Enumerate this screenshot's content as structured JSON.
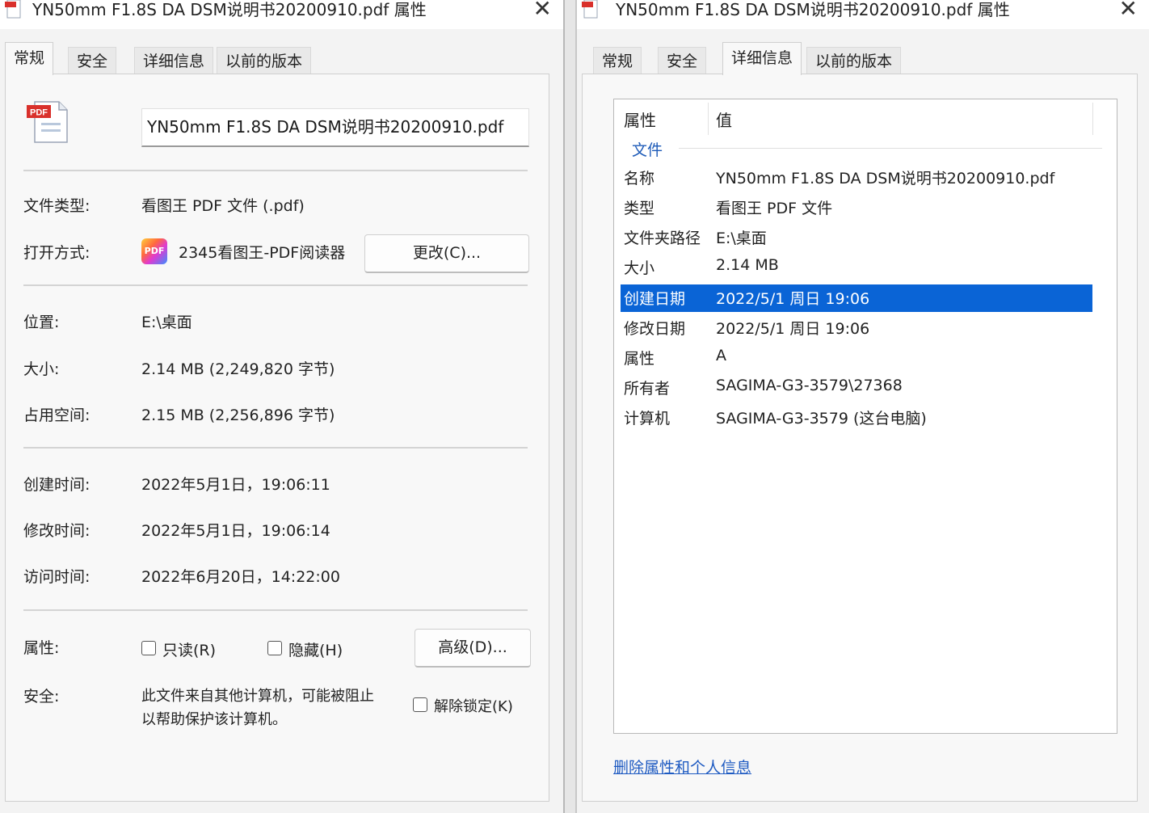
{
  "left": {
    "title": "YN50mm F1.8S DA DSM说明书20200910.pdf 属性",
    "close": "✕",
    "tabs": [
      {
        "label": "常规",
        "active": true
      },
      {
        "label": "安全",
        "active": false
      },
      {
        "label": "详细信息",
        "active": false
      },
      {
        "label": "以前的版本",
        "active": false
      }
    ],
    "pdf_badge": "PDF",
    "file_name": "YN50mm F1.8S DA DSM说明书20200910.pdf",
    "file_type_label": "文件类型:",
    "file_type_value": "看图王 PDF 文件 (.pdf)",
    "open_with_label": "打开方式:",
    "open_with_icon_text": "PDF",
    "open_with_value": "2345看图王-PDF阅读器",
    "change_button": "更改(C)...",
    "location_label": "位置:",
    "location_value": "E:\\桌面",
    "size_label": "大小:",
    "size_value": "2.14 MB (2,249,820 字节)",
    "disk_label": "占用空间:",
    "disk_value": "2.15 MB (2,256,896 字节)",
    "created_label": "创建时间:",
    "created_value": "2022年5月1日，19:06:11",
    "modified_label": "修改时间:",
    "modified_value": "2022年5月1日，19:06:14",
    "accessed_label": "访问时间:",
    "accessed_value": "2022年6月20日，14:22:00",
    "attributes_label": "属性:",
    "readonly_label": "只读(R)",
    "hidden_label": "隐藏(H)",
    "advanced_button": "高级(D)...",
    "security_label": "安全:",
    "security_line1": "此文件来自其他计算机，可能被阻止",
    "security_line2": "以帮助保护该计算机。",
    "unblock_label": "解除锁定(K)"
  },
  "right": {
    "title": "YN50mm F1.8S DA DSM说明书20200910.pdf 属性",
    "close": "✕",
    "tabs": [
      {
        "label": "常规",
        "active": false
      },
      {
        "label": "安全",
        "active": false
      },
      {
        "label": "详细信息",
        "active": true
      },
      {
        "label": "以前的版本",
        "active": false
      }
    ],
    "col_property": "属性",
    "col_value": "值",
    "group": "文件",
    "rows": [
      {
        "k": "名称",
        "v": "YN50mm F1.8S DA DSM说明书20200910.pdf"
      },
      {
        "k": "类型",
        "v": "看图王 PDF 文件"
      },
      {
        "k": "文件夹路径",
        "v": "E:\\桌面"
      },
      {
        "k": "大小",
        "v": "2.14 MB"
      },
      {
        "k": "创建日期",
        "v": "2022/5/1 周日 19:06",
        "selected": true
      },
      {
        "k": "修改日期",
        "v": "2022/5/1 周日 19:06"
      },
      {
        "k": "属性",
        "v": "A"
      },
      {
        "k": "所有者",
        "v": "SAGIMA-G3-3579\\27368"
      },
      {
        "k": "计算机",
        "v": "SAGIMA-G3-3579 (这台电脑)"
      }
    ],
    "remove_link": "删除属性和个人信息"
  },
  "colors": {
    "selection": "#0a64d6",
    "link": "#1f5bc2",
    "pdf_red": "#d9302b"
  }
}
